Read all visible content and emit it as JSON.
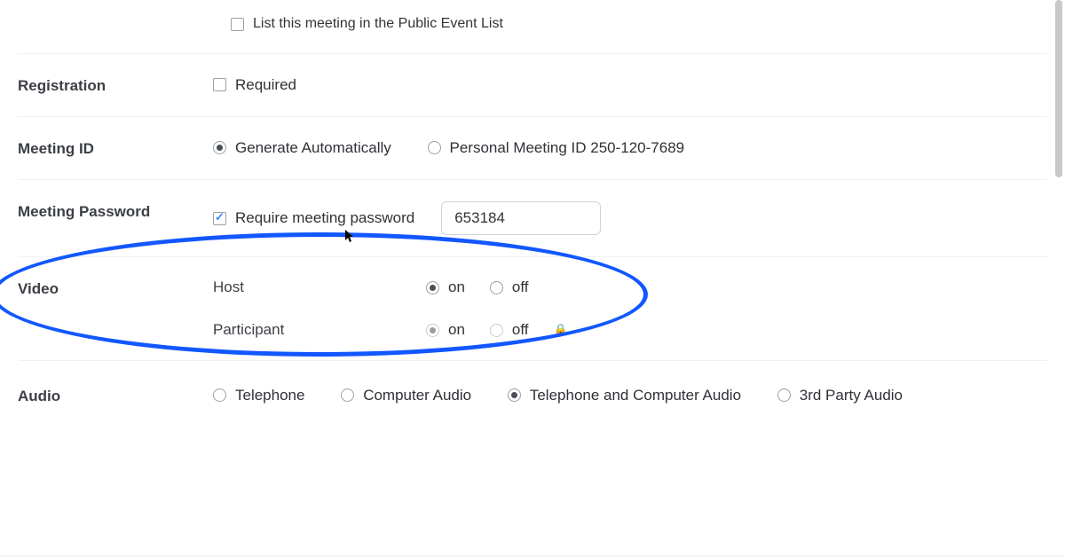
{
  "public_list": {
    "label": "List this meeting in the Public Event List",
    "checked": false
  },
  "registration": {
    "section_label": "Registration",
    "required_label": "Required",
    "required_checked": false
  },
  "meeting_id": {
    "section_label": "Meeting ID",
    "auto_label": "Generate Automatically",
    "personal_label": "Personal Meeting ID 250-120-7689",
    "selected": "auto"
  },
  "meeting_password": {
    "section_label": "Meeting Password",
    "require_label": "Require meeting password",
    "require_checked": true,
    "value": "653184"
  },
  "video": {
    "section_label": "Video",
    "host_label": "Host",
    "participant_label": "Participant",
    "on_label": "on",
    "off_label": "off",
    "host_selected": "on",
    "participant_selected": "on",
    "participant_locked": true
  },
  "audio": {
    "section_label": "Audio",
    "telephone_label": "Telephone",
    "computer_label": "Computer Audio",
    "both_label": "Telephone and Computer Audio",
    "thirdparty_label": "3rd Party Audio",
    "selected": "both"
  },
  "annotation": {
    "ellipse_color": "#1257ff"
  }
}
